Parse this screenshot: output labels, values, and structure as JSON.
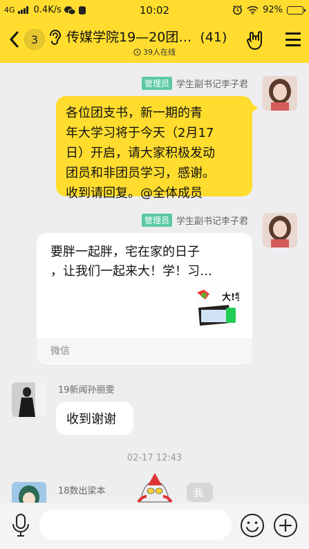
{
  "status_bar": {
    "network": "4G",
    "speed": "0.4K/s",
    "time": "10:02",
    "battery": "92%",
    "battery_level": 0.92
  },
  "header": {
    "unread_count": "3",
    "title": "传媒学院19—20团…",
    "member_count": "(41)",
    "online": "39人在线"
  },
  "messages": [
    {
      "tag": "管理员",
      "sender": "学生副书记李子君",
      "lines": [
        "各位团支书，新一期的青",
        "年大学习将于今天（2月17",
        "日）开启，请大家积极发动",
        "团员和非团员学习，感谢。",
        "收到请回复。@全体成员"
      ]
    },
    {
      "tag": "管理员",
      "sender": "学生副书记李子君",
      "card_lines": [
        "要胖一起胖，宅在家的日子",
        "，让我们一起来大！学！习…"
      ],
      "thumb_text": "大!学",
      "source": "微信"
    },
    {
      "sender": "19新闻孙丽雯",
      "text": "收到谢谢"
    },
    {
      "sender": "18数出梁本",
      "text": "我"
    }
  ],
  "timestamp": "02-17 12:43",
  "colors": {
    "brand_yellow": "#ffdc2e",
    "admin_tag": "#5bc9a4",
    "chat_bg": "#eeeef0"
  },
  "icons": {
    "back": "chevron-left-icon",
    "ear": "ear-icon",
    "hand": "rock-hand-icon",
    "menu": "menu-icon",
    "mic": "microphone-icon",
    "emoji": "smiley-icon",
    "plus": "plus-circle-icon"
  }
}
